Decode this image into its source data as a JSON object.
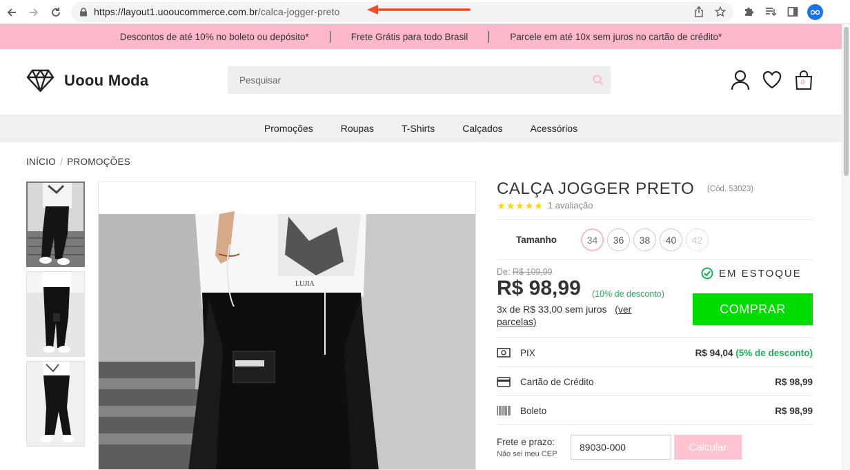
{
  "browser": {
    "url_host": "https://layout1.uooucommerce.com.br",
    "url_path": "/calca-jogger-preto"
  },
  "promo_bar": {
    "items": [
      "Descontos de até 10% no boleto ou depósito*",
      "Frete Grátis para todo Brasil",
      "Parcele em até 10x sem juros no cartão de crédito*"
    ]
  },
  "header": {
    "logo_text": "Uoou Moda",
    "search_placeholder": "Pesquisar",
    "cart_count": "0"
  },
  "categories": [
    "Promoções",
    "Roupas",
    "T-Shirts",
    "Calçados",
    "Acessórios"
  ],
  "breadcrumb": [
    "INÍCIO",
    "PROMOÇÕES"
  ],
  "product": {
    "name": "CALÇA JOGGER PRETO",
    "code": "(Cód. 53023)",
    "rating_stars": 5,
    "reviews": "1 avaliação",
    "size_label": "Tamanho",
    "sizes": [
      "34",
      "36",
      "38",
      "40",
      "42"
    ],
    "selected_size": "34",
    "unavailable_size": "42",
    "old_price_prefix": "De:",
    "old_price": "R$ 109,99",
    "price": "R$ 98,99",
    "discount": "(10% de desconto)",
    "installments_text": "3x de R$ 33,00 sem juros",
    "installments_link": "(ver parcelas)",
    "stock": "EM ESTOQUE",
    "buy_label": "COMPRAR"
  },
  "payments": [
    {
      "icon": "pix-cash-icon",
      "name": "PIX",
      "value": "R$ 94,04",
      "extra": "(5% de desconto)"
    },
    {
      "icon": "credit-card-icon",
      "name": "Cartão de Crédito",
      "value": "R$ 98,99",
      "extra": ""
    },
    {
      "icon": "barcode-icon",
      "name": "Boleto",
      "value": "R$ 98,99",
      "extra": ""
    }
  ],
  "shipping": {
    "label": "Frete e prazo:",
    "help": "Não sei meu CEP",
    "cep_value": "89030-000",
    "calc_label": "Calcular"
  },
  "colors": {
    "promo_bg": "#ffb8cb",
    "buy_button": "#00dc00",
    "discount_green": "#19b35b",
    "annotation_arrow": "#f04e23"
  }
}
